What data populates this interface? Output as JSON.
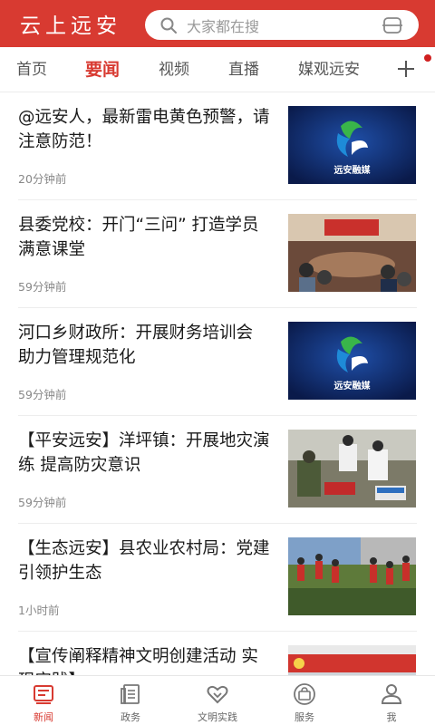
{
  "header": {
    "app_title": "云上远安",
    "search_placeholder": "大家都在搜",
    "brand_color": "#d83a31"
  },
  "tabs": [
    {
      "label": "首页",
      "active": false
    },
    {
      "label": "要闻",
      "active": true
    },
    {
      "label": "视频",
      "active": false
    },
    {
      "label": "直播",
      "active": false
    },
    {
      "label": "媒观远安",
      "active": false
    }
  ],
  "news": [
    {
      "title": "@远安人，最新雷电黄色预警，请注意防范！",
      "time": "20分钟前",
      "thumb": "远安融媒 logo"
    },
    {
      "title": "县委党校：开门“三问” 打造学员满意课堂",
      "time": "59分钟前",
      "thumb": "meeting photo"
    },
    {
      "title": "河口乡财政所：开展财务培训会 助力管理规范化",
      "time": "59分钟前",
      "thumb": "远安融媒 logo"
    },
    {
      "title": "【平安远安】洋坪镇：开展地灾演练 提高防灾意识",
      "time": "59分钟前",
      "thumb": "drill photo"
    },
    {
      "title": "【生态远安】县农业农村局：党建引领护生态",
      "time": "1小时前",
      "thumb": "field photo"
    },
    {
      "title": "【宣传阐释精神文明创建活动 实现实践】...",
      "time": "",
      "thumb": "banner photo"
    }
  ],
  "thumb_logo_text": "远安融媒",
  "bottom_nav": [
    {
      "label": "新闻",
      "icon": "news-icon",
      "active": true
    },
    {
      "label": "政务",
      "icon": "government-icon",
      "active": false
    },
    {
      "label": "文明实践",
      "icon": "heart-icon",
      "active": false
    },
    {
      "label": "服务",
      "icon": "service-bag-icon",
      "active": false
    },
    {
      "label": "我",
      "icon": "user-icon",
      "active": false
    }
  ]
}
